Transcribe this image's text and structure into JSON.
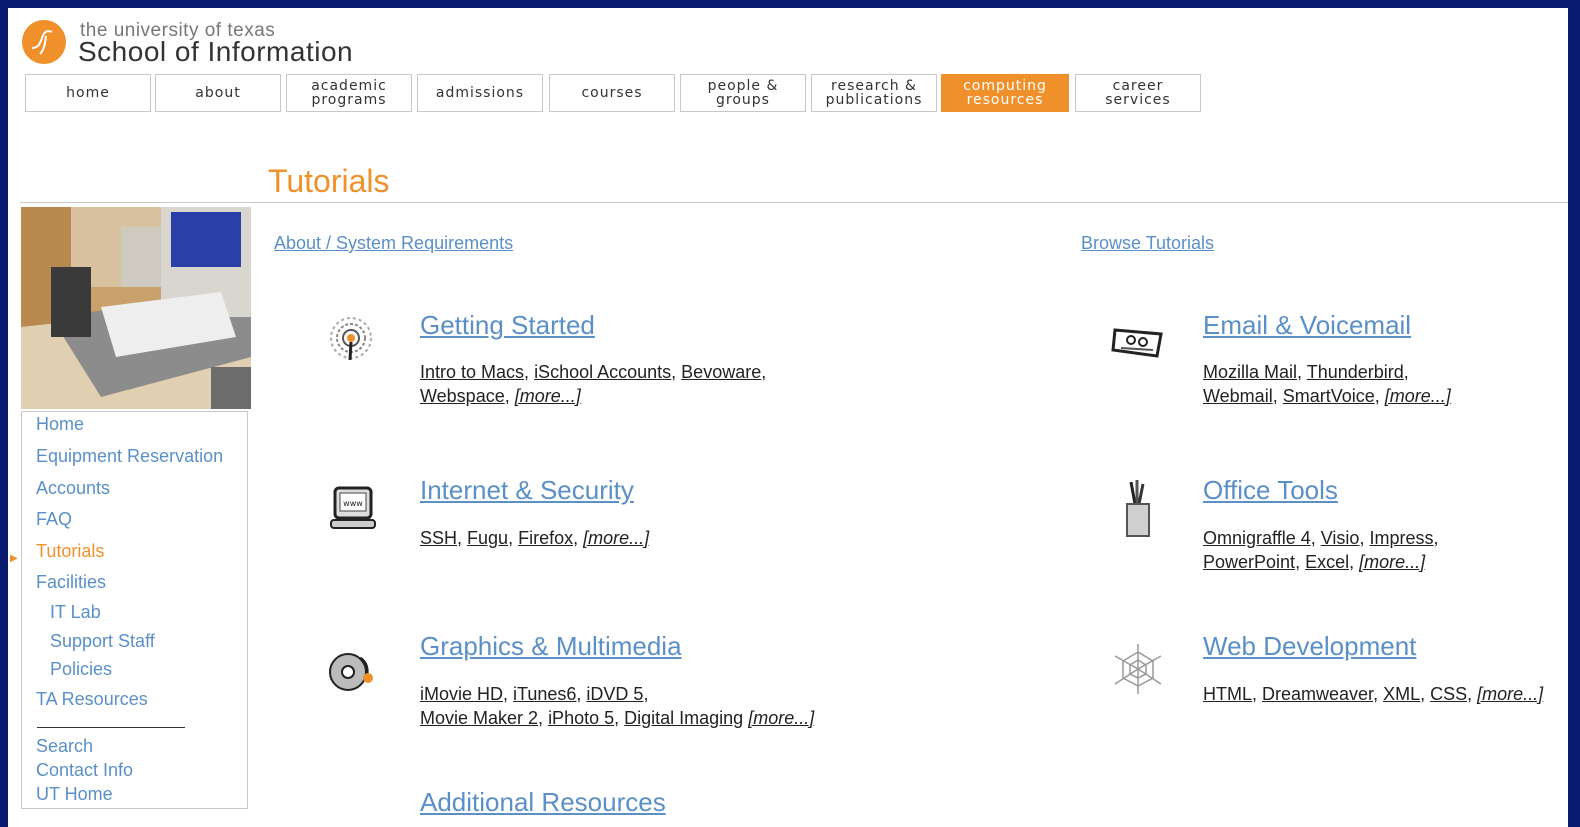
{
  "header": {
    "university": "the university of texas",
    "school": "School of Information",
    "brand_color": "#f0902a"
  },
  "nav": [
    {
      "label": "home",
      "active": false
    },
    {
      "label": "about",
      "active": false
    },
    {
      "label": "academic\nprograms",
      "active": false
    },
    {
      "label": "admissions",
      "active": false
    },
    {
      "label": "courses",
      "active": false
    },
    {
      "label": "people &\ngroups",
      "active": false
    },
    {
      "label": "research &\npublications",
      "active": false
    },
    {
      "label": "computing\nresources",
      "active": true
    },
    {
      "label": "career\nservices",
      "active": false
    }
  ],
  "page_title": "Tutorials",
  "sidebar": {
    "items": [
      {
        "label": "Home"
      },
      {
        "label": "Equipment Reservation"
      },
      {
        "label": "Accounts"
      },
      {
        "label": "FAQ"
      },
      {
        "label": "Tutorials",
        "active": true
      },
      {
        "label": "Facilities"
      },
      {
        "label": "IT Lab"
      },
      {
        "label": "Support Staff"
      },
      {
        "label": "Policies"
      },
      {
        "label": "TA Resources"
      },
      {
        "label": "Search"
      },
      {
        "label": "Contact Info"
      },
      {
        "label": "UT Home"
      }
    ]
  },
  "main": {
    "about_link": "About / System Requirements",
    "browse_link": "Browse Tutorials",
    "categories": [
      {
        "title": "Getting Started",
        "icon": "antenna-icon",
        "line1": [
          {
            "t": "Intro to Macs"
          },
          {
            "t": "iSchool Accounts"
          },
          {
            "t": "Bevoware"
          }
        ],
        "line2": [
          {
            "t": "Webspace"
          }
        ],
        "more": "[more...]"
      },
      {
        "title": "Email & Voicemail",
        "icon": "envelope-icon",
        "line1": [
          {
            "t": "Mozilla Mail"
          },
          {
            "t": "Thunderbird"
          }
        ],
        "line2": [
          {
            "t": "Webmail"
          },
          {
            "t": "SmartVoice"
          }
        ],
        "more": "[more...]"
      },
      {
        "title": "Internet & Security",
        "icon": "www-computer-icon",
        "line1": [
          {
            "t": "SSH"
          },
          {
            "t": "Fugu"
          },
          {
            "t": "Firefox"
          }
        ],
        "line2": [],
        "more": "[more...]"
      },
      {
        "title": "Office Tools",
        "icon": "pencil-cup-icon",
        "line1": [
          {
            "t": "Omnigraffle 4"
          },
          {
            "t": "Visio"
          },
          {
            "t": "Impress"
          }
        ],
        "line2": [
          {
            "t": "PowerPoint"
          },
          {
            "t": "Excel"
          }
        ],
        "more": "[more...]"
      },
      {
        "title": "Graphics & Multimedia",
        "icon": "disc-icon",
        "line1": [
          {
            "t": "iMovie HD"
          },
          {
            "t": "iTunes6"
          },
          {
            "t": "iDVD 5"
          }
        ],
        "line2": [
          {
            "t": "Movie Maker 2"
          },
          {
            "t": "iPhoto 5"
          },
          {
            "t": "Digital Imaging"
          }
        ],
        "more": "[more...]"
      },
      {
        "title": "Web Development",
        "icon": "spiderweb-icon",
        "line1": [
          {
            "t": "HTML"
          },
          {
            "t": "Dreamweaver"
          },
          {
            "t": "XML"
          },
          {
            "t": "CSS"
          }
        ],
        "line2": [],
        "more": "[more...]"
      },
      {
        "title": "Additional Resources",
        "icon": "",
        "line1": [],
        "line2": [],
        "more": ""
      }
    ]
  }
}
